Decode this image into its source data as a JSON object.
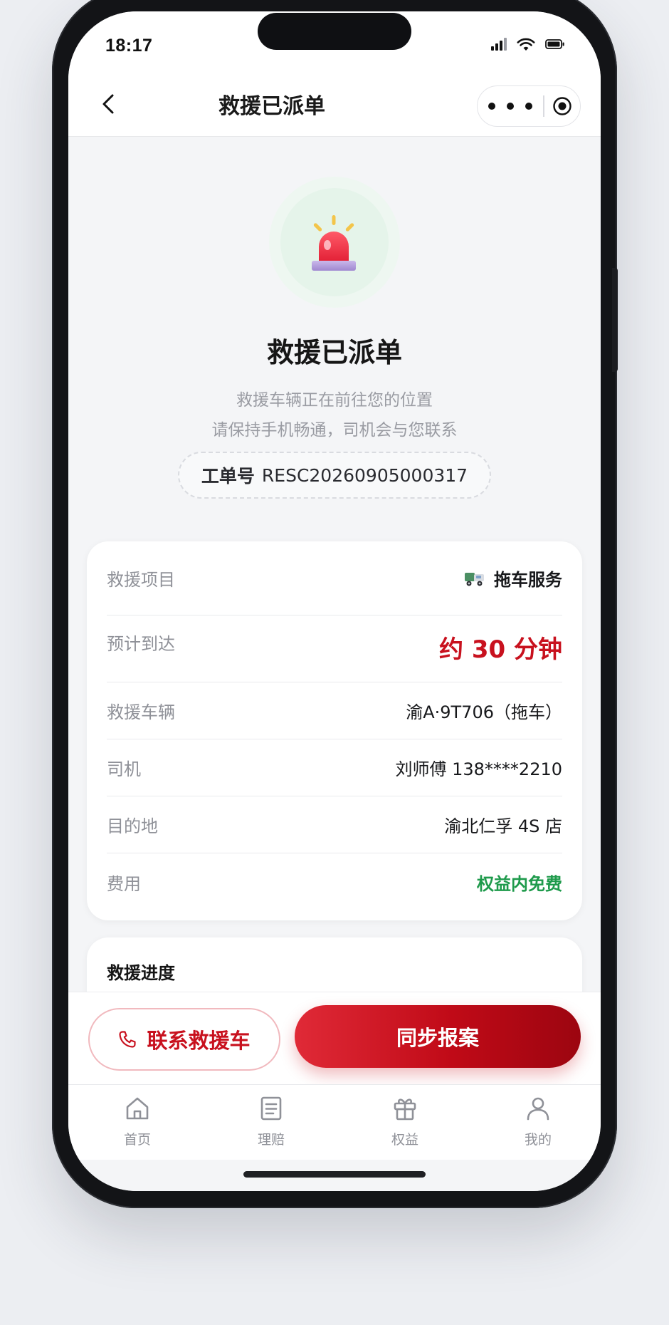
{
  "status_bar": {
    "time": "18:17"
  },
  "nav": {
    "title": "救援已派单"
  },
  "hero": {
    "title": "救援已派单",
    "line1": "救援车辆正在前往您的位置",
    "line2": "请保持手机畅通，司机会与您联系"
  },
  "order": {
    "label": "工单号",
    "number": "RESC20260905000317"
  },
  "info": [
    {
      "label": "救援项目",
      "value": "拖车服务"
    },
    {
      "label": "预计到达",
      "value": "约 30 分钟"
    },
    {
      "label": "救援车辆",
      "value": "渝A·9T706（拖车）"
    },
    {
      "label": "司机",
      "value": "刘师傅 138****2210"
    },
    {
      "label": "目的地",
      "value": "渝北仁孚 4S 店"
    },
    {
      "label": "费用",
      "value": "权益内免费"
    }
  ],
  "progress": {
    "title": "救援进度"
  },
  "actions": {
    "contact_label": "联系救援车",
    "sync_label": "同步报案"
  },
  "tabs": [
    {
      "label": "首页",
      "icon": "home-icon"
    },
    {
      "label": "理赔",
      "icon": "document-icon"
    },
    {
      "label": "权益",
      "icon": "gift-icon"
    },
    {
      "label": "我的",
      "icon": "user-icon"
    }
  ],
  "colors": {
    "accent": "#c8111e",
    "success": "#1e9a4b",
    "muted": "#8f9198"
  }
}
